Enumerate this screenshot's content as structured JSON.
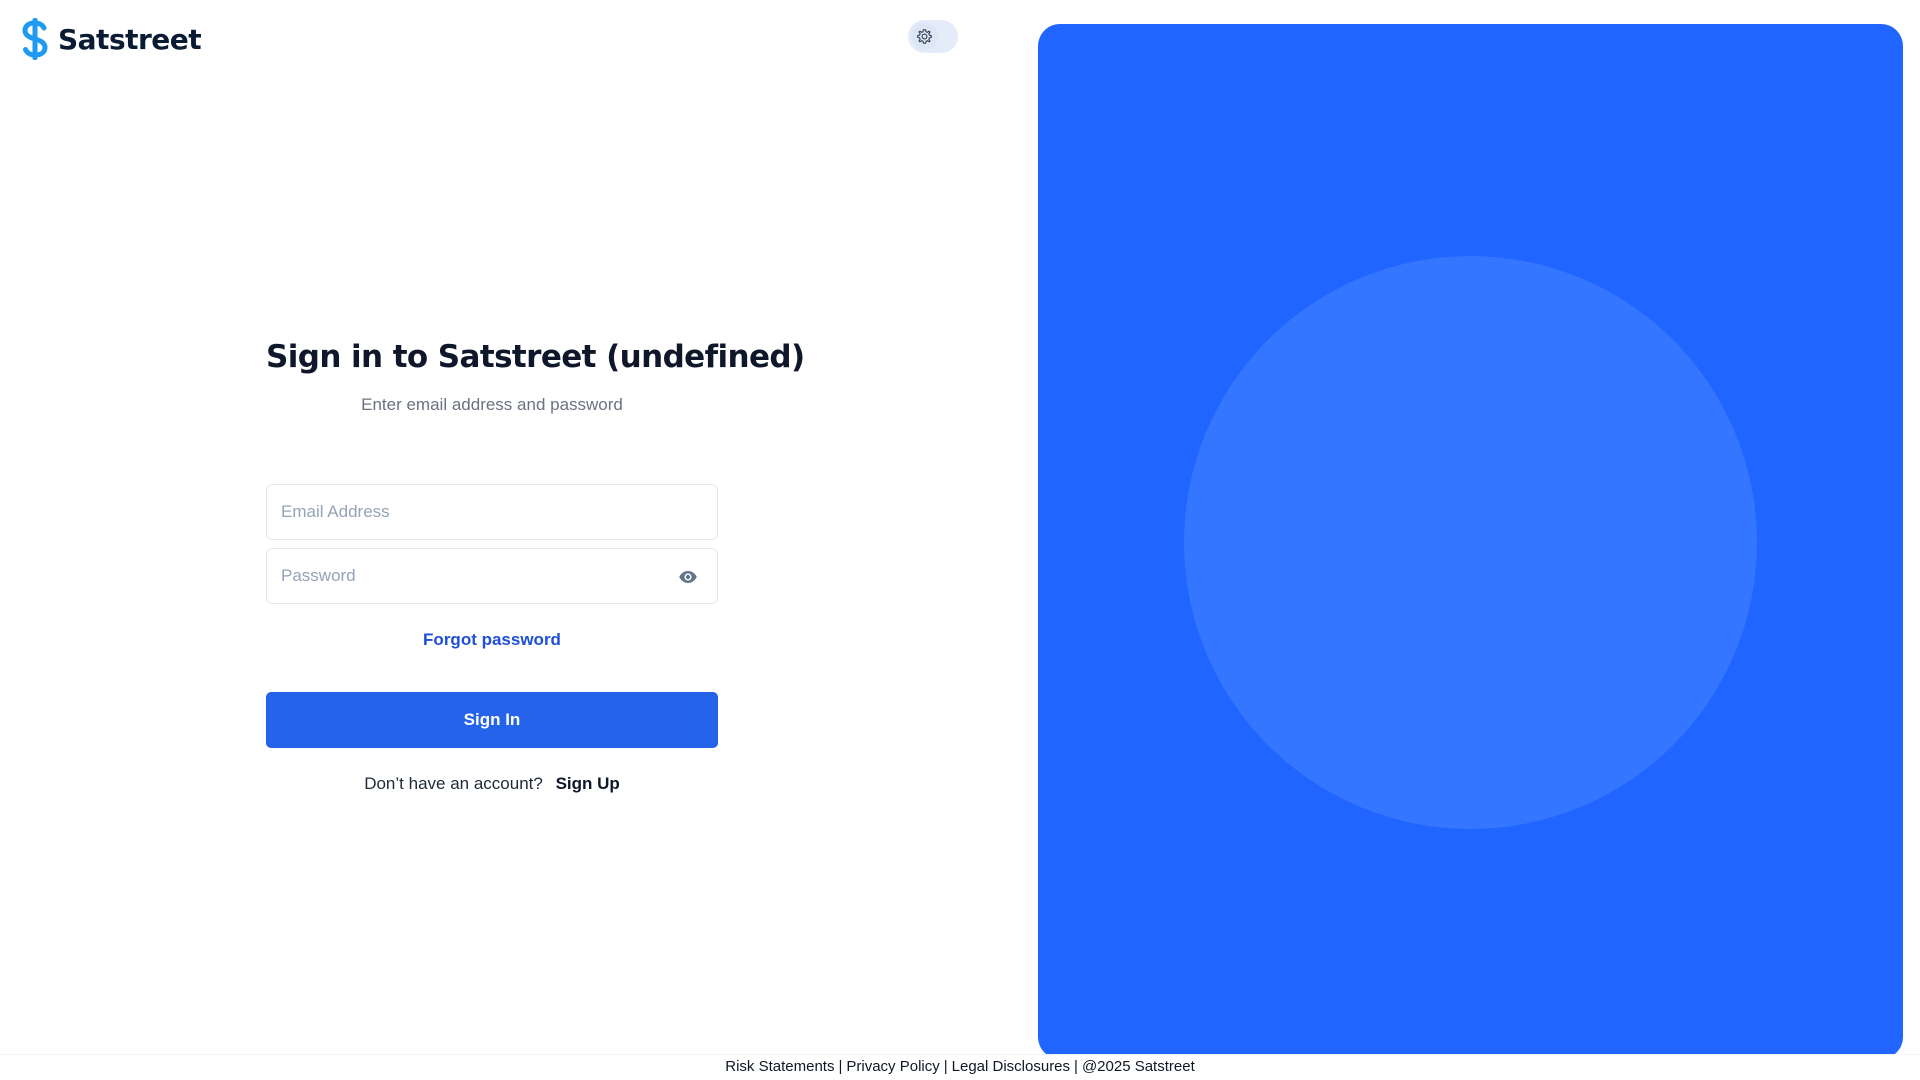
{
  "header": {
    "brand_name": "Satstreet",
    "logo_icon": "satstreet-s-logo",
    "theme_toggle_icon": "gear-icon"
  },
  "signin": {
    "title": "Sign in to Satstreet (undefined)",
    "subtitle": "Enter email address and password",
    "email_placeholder": "Email Address",
    "email_value": "",
    "password_placeholder": "Password",
    "password_value": "",
    "password_toggle_icon": "eye-icon",
    "forgot_label": "Forgot password",
    "submit_label": "Sign In",
    "no_account_text": "Don’t have an account?",
    "signup_label": "Sign Up"
  },
  "footer": {
    "links": [
      "Risk Statements",
      "Privacy Policy",
      "Legal Disclosures"
    ],
    "separator": "|",
    "copyright": "@2025 Satstreet"
  },
  "colors": {
    "accent": "#2563eb",
    "hero_background": "#2065ff",
    "hero_circle": "#3476ff",
    "logo_blue": "#1e9bf0",
    "link": "#1e4fd6",
    "text_primary": "#0f172a",
    "text_muted": "#6b7280"
  }
}
